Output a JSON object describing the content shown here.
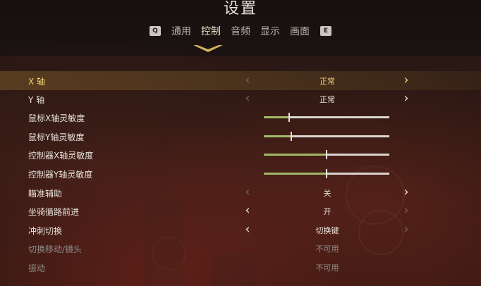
{
  "header": {
    "title": "设置",
    "prev_key": "Q",
    "next_key": "E",
    "tabs": [
      {
        "label": "通用",
        "active": false
      },
      {
        "label": "控制",
        "active": true
      },
      {
        "label": "音频",
        "active": false
      },
      {
        "label": "显示",
        "active": false
      },
      {
        "label": "画面",
        "active": false
      }
    ]
  },
  "settings": [
    {
      "label": "X 轴",
      "type": "select",
      "value": "正常",
      "selected": true,
      "left_enabled": false,
      "right_enabled": true
    },
    {
      "label": "Y 轴",
      "type": "select",
      "value": "正常",
      "left_enabled": false,
      "right_enabled": true
    },
    {
      "label": "鼠标X轴灵敏度",
      "type": "slider",
      "level": 0.2
    },
    {
      "label": "鼠标Y轴灵敏度",
      "type": "slider",
      "level": 0.22
    },
    {
      "label": "控制器X轴灵敏度",
      "type": "slider",
      "level": 0.5
    },
    {
      "label": "控制器Y轴灵敏度",
      "type": "slider",
      "level": 0.5
    },
    {
      "label": "瞄准辅助",
      "type": "select",
      "value": "关",
      "left_enabled": false,
      "right_enabled": true
    },
    {
      "label": "坐骑循路前进",
      "type": "select",
      "value": "开",
      "left_enabled": true,
      "right_enabled": false
    },
    {
      "label": "冲刺切换",
      "type": "select",
      "value": "切换键",
      "left_enabled": true,
      "right_enabled": false
    },
    {
      "label": "切换移动/镜头",
      "type": "readonly",
      "value": "不可用",
      "disabled": true
    },
    {
      "label": "振动",
      "type": "readonly",
      "value": "不可用",
      "disabled": true
    }
  ],
  "colors": {
    "accent_gold": "#f2d27a",
    "slider_fill": "#a3b868"
  }
}
